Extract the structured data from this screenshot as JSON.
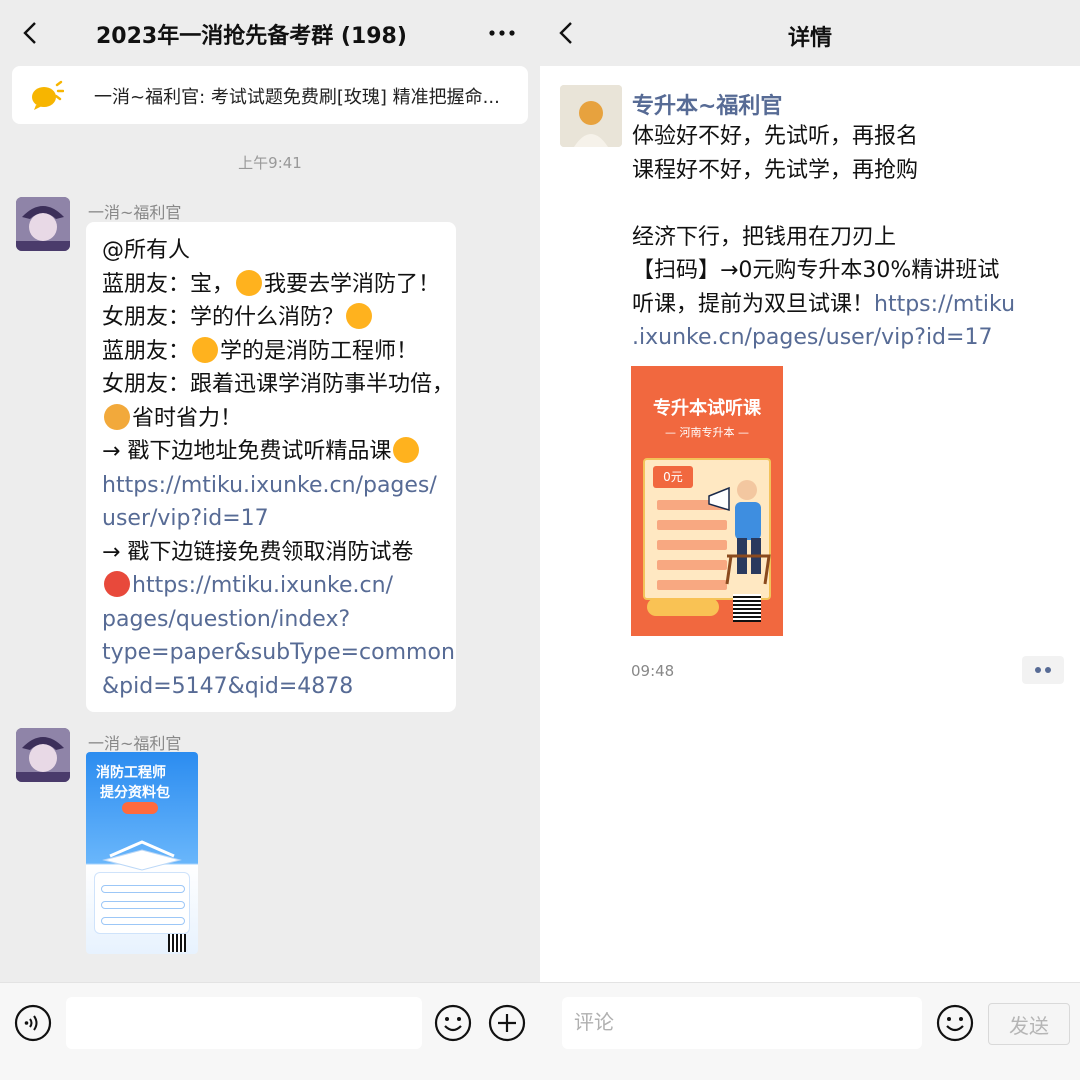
{
  "left": {
    "title": "2023年一消抢先备考群 (198)",
    "notice": "一消~福利官: 考试试题免费刷[玫瑰] 精准把握命...",
    "time": "上午9:41",
    "sender1": "一消~福利官",
    "message_lines": [
      {
        "text": "@所有人"
      },
      {
        "text": "蓝朋友：宝，",
        "emoji": "#ffb21e",
        "text2": "我要去学消防了！"
      },
      {
        "text": "女朋友：学的什么消防？",
        "emoji_end": "#ffb21e"
      },
      {
        "text": "蓝朋友：",
        "emoji": "#ffb21e",
        "text2": "学的是消防工程师！"
      },
      {
        "text": "女朋友：跟着迅课学消防事半功倍，"
      },
      {
        "emoji": "#f2a93b",
        "text2": "省时省力！"
      },
      {
        "text": "→ 戳下边地址免费试听精品课",
        "emoji_end": "#ffb21e"
      },
      {
        "link": "https://mtiku.ixunke.cn/pages/"
      },
      {
        "link": "user/vip?id=17"
      },
      {
        "text": "→ 戳下边链接免费领取消防试卷"
      },
      {
        "emoji": "#e8493b",
        "link": "https://mtiku.ixunke.cn/"
      },
      {
        "link": "pages/question/index?"
      },
      {
        "link": "type=paper&subType=common"
      },
      {
        "link": "&pid=5147&qid=4878"
      }
    ],
    "sender2": "一消~福利官",
    "poster": {
      "line1": "消防工程师",
      "line2": "提分资料包"
    },
    "input_value": ""
  },
  "right": {
    "title": "详情",
    "author": "专升本~福利官",
    "body_lines": [
      {
        "text": "体验好不好，先试听，再报名"
      },
      {
        "text": "课程好不好，先试学，再抢购"
      },
      {
        "text": ""
      },
      {
        "text": "经济下行，把钱用在刀刃上"
      },
      {
        "text": "【扫码】→0元购专升本30%精讲班试"
      },
      {
        "text": "听课，提前为双旦试课！",
        "link": "https://mtiku"
      },
      {
        "link": ".ixunke.cn/pages/user/vip?id=17"
      }
    ],
    "poster": {
      "title": "专升本试听课",
      "subtitle": "— 河南专升本 —",
      "price": "0元"
    },
    "time": "09:48",
    "comment_placeholder": "评论",
    "send_label": "发送"
  },
  "colors": {
    "link": "#576b95",
    "accent_orange": "#f1683f",
    "poster_blue": "#2b8cf0"
  }
}
